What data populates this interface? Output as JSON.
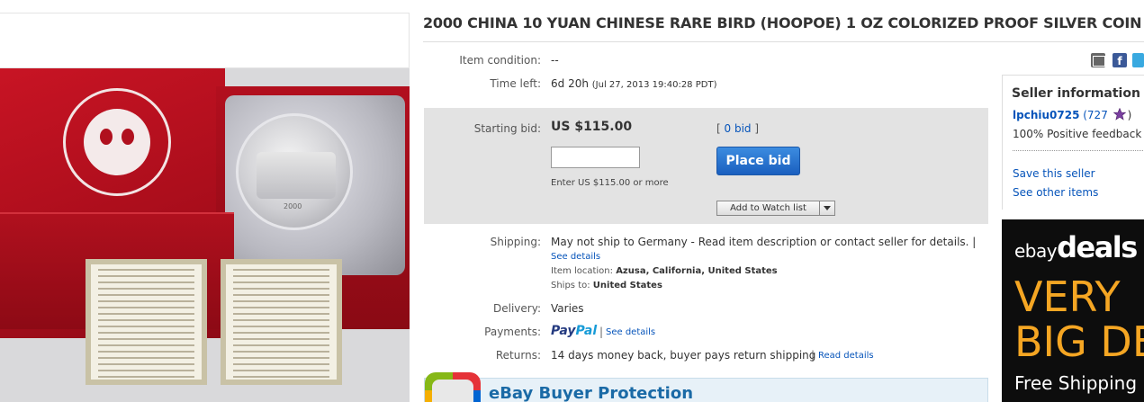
{
  "listing": {
    "title": "2000 CHINA 10 YUAN CHINESE RARE BIRD (HOOPOE) 1 OZ COLORIZED PROOF SILVER COIN"
  },
  "photo": {
    "coin_year": "2000"
  },
  "details": {
    "item_condition_label": "Item condition:",
    "item_condition_value": "--",
    "time_left_label": "Time left:",
    "time_left_value": "6d 20h",
    "time_left_end": "(Jul 27, 2013  19:40:28 PDT)"
  },
  "bid": {
    "starting_bid_label": "Starting bid:",
    "price": "US $115.00",
    "bids_open": "[ ",
    "bids_link": "0 bid",
    "bids_close": " ]",
    "input_value": "",
    "enter_note": "Enter US $115.00 or more",
    "place_bid_label": "Place bid",
    "watch_label": "Add to Watch list"
  },
  "shipping": {
    "label": "Shipping:",
    "text": "May not ship to Germany - Read item description or contact seller for details. |",
    "see_details": "See details",
    "item_location_label": "Item location:",
    "item_location_value": "Azusa, California, United States",
    "ships_to_label": "Ships to:",
    "ships_to_value": "United States"
  },
  "delivery": {
    "label": "Delivery:",
    "value": "Varies"
  },
  "payments": {
    "label": "Payments:",
    "paypal_a": "Pay",
    "paypal_b": "Pal",
    "separator": "|",
    "see_details": "See details"
  },
  "returns": {
    "label": "Returns:",
    "text": "14 days money back, buyer pays return shipping",
    "separator": "|",
    "read_details": "Read details"
  },
  "protection": {
    "title": "eBay Buyer Protection"
  },
  "seller": {
    "heading": "Seller information",
    "username": "lpchiu0725",
    "score_open": " (727 ",
    "score_close": ")",
    "positive_feedback": "100% Positive feedback",
    "save_seller": "Save this seller",
    "other_items": "See other items"
  },
  "ad": {
    "logo_ebay": "ebay",
    "logo_deals": "deals",
    "line1": "VERY",
    "line2": "BIG DE",
    "line3": "Free Shipping"
  },
  "colors": {
    "link": "#0654ba",
    "place_bid": "#1a5fbf",
    "ad_accent": "#f5a623"
  }
}
